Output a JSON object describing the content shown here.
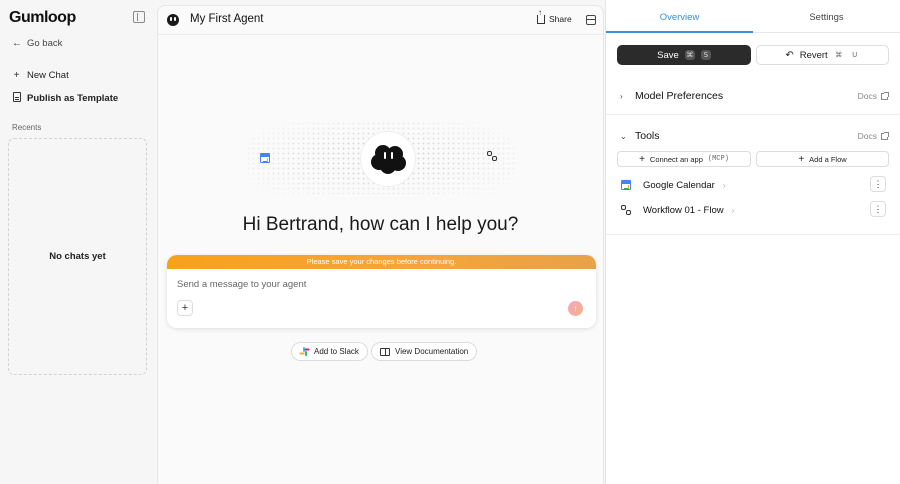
{
  "app": {
    "logo_text": "Gumloop"
  },
  "sidebar": {
    "go_back": "Go back",
    "new_chat": "New Chat",
    "publish": "Publish as Template",
    "recents_label": "Recents",
    "empty_state": "No chats yet"
  },
  "center": {
    "agent_title": "My First Agent",
    "share_label": "Share",
    "greeting": "Hi Bertrand, how can I help you?",
    "warning": "Please save your changes before continuing.",
    "message_placeholder": "Send a message to your agent",
    "plus_label": "+",
    "send_label": "↑",
    "add_to_slack": "Add to Slack",
    "view_docs": "View Documentation"
  },
  "right_panel": {
    "tabs": [
      {
        "label": "Overview",
        "active": true
      },
      {
        "label": "Settings",
        "active": false
      }
    ],
    "save_label": "Save",
    "save_shortcut": [
      "⌘",
      "S"
    ],
    "revert_label": "Revert",
    "revert_shortcut": [
      "⌘",
      "U"
    ],
    "model_preferences": {
      "title": "Model Preferences",
      "docs": "Docs"
    },
    "tools": {
      "title": "Tools",
      "docs": "Docs",
      "connect_label": "Connect an app",
      "connect_tag": "(MCP)",
      "add_flow_label": "Add a Flow",
      "items": [
        {
          "name": "Google Calendar",
          "icon": "google-calendar-icon"
        },
        {
          "name": "Workflow 01 - Flow",
          "icon": "workflow-icon"
        }
      ]
    }
  },
  "colors": {
    "accent": "#3a8fd6",
    "warning_start": "#f7a21b",
    "warning_end": "#e7a24a",
    "save_bg": "#2b2b2b"
  }
}
